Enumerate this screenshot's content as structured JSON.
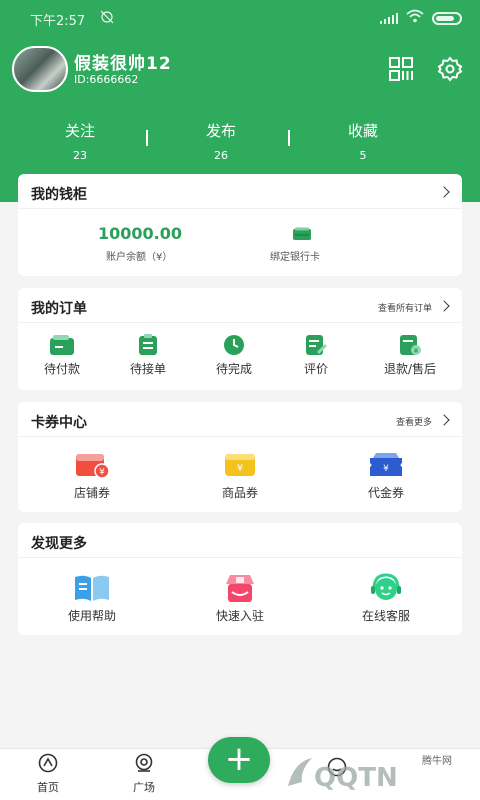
{
  "status_bar": {
    "time": "下午2:57"
  },
  "profile": {
    "username": "假装很帅12",
    "user_id": "ID:6666662"
  },
  "stats": [
    {
      "label": "关注",
      "value": "23"
    },
    {
      "label": "发布",
      "value": "26"
    },
    {
      "label": "收藏",
      "value": "5"
    }
  ],
  "wallet": {
    "title": "我的钱柜",
    "balance": "10000.00",
    "balance_label": "账户余额（¥）",
    "bank_card_label": "绑定银行卡"
  },
  "orders": {
    "title": "我的订单",
    "more": "查看所有订单",
    "items": [
      "待付款",
      "待接单",
      "待完成",
      "评价",
      "退款/售后"
    ]
  },
  "coupons": {
    "title": "卡券中心",
    "more": "查看更多",
    "items": [
      "店铺券",
      "商品券",
      "代金券"
    ]
  },
  "discover": {
    "title": "发现更多",
    "items": [
      "使用帮助",
      "快速入驻",
      "在线客服"
    ]
  },
  "tabbar": {
    "items": [
      "首页",
      "广场"
    ],
    "fab_label": "+"
  },
  "watermark": {
    "site_name": "腾牛网",
    "logo_text": "QQTN"
  },
  "colors": {
    "brand_green": "#2eab5c",
    "amount_green": "#2aa05a",
    "coupon_red": "#f04e3e",
    "coupon_yellow": "#f5c21b",
    "coupon_blue": "#2d5bd0",
    "help_blue": "#3aa0e8",
    "shop_pink": "#f4456a",
    "service_green": "#2fd18a"
  }
}
